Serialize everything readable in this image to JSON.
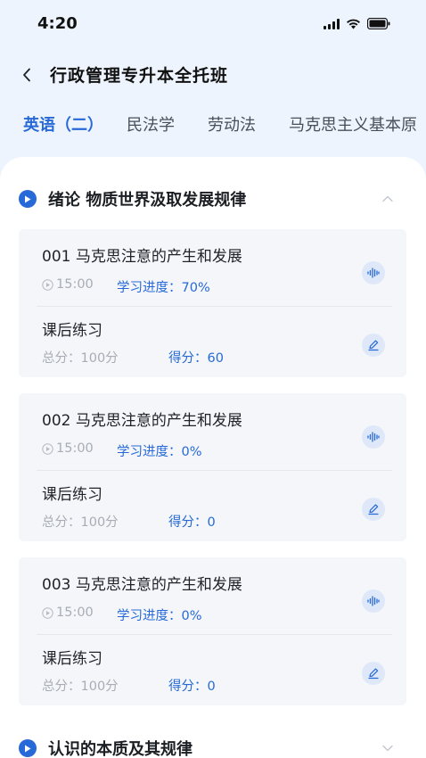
{
  "status_bar": {
    "time": "4:20"
  },
  "header": {
    "back_icon": "chevron-left-icon",
    "title": "行政管理专升本全托班"
  },
  "tabs": [
    {
      "label": "英语（二）",
      "active": true
    },
    {
      "label": "民法学",
      "active": false
    },
    {
      "label": "劳动法",
      "active": false
    },
    {
      "label": "马克思主义基本原",
      "active": false
    }
  ],
  "sections": [
    {
      "title": "绪论 物质世界汲取发展规律",
      "expanded": true,
      "lessons": [
        {
          "title": "001 马克思注意的产生和发展",
          "duration": "15:00",
          "progress": "学习进度：70%",
          "exercise_title": "课后练习",
          "total_score": "总分：100分",
          "score": "得分：60"
        },
        {
          "title": "002 马克思注意的产生和发展",
          "duration": "15:00",
          "progress": "学习进度：0%",
          "exercise_title": "课后练习",
          "total_score": "总分：100分",
          "score": "得分：0"
        },
        {
          "title": "003 马克思注意的产生和发展",
          "duration": "15:00",
          "progress": "学习进度：0%",
          "exercise_title": "课后练习",
          "total_score": "总分：100分",
          "score": "得分：0"
        }
      ]
    },
    {
      "title": "认识的本质及其规律",
      "expanded": false,
      "lessons": []
    }
  ],
  "colors": {
    "accent": "#2769d6",
    "page_bg": "#eef4fd",
    "card_bg": "#f4f6f9",
    "muted": "#a8adb5"
  }
}
